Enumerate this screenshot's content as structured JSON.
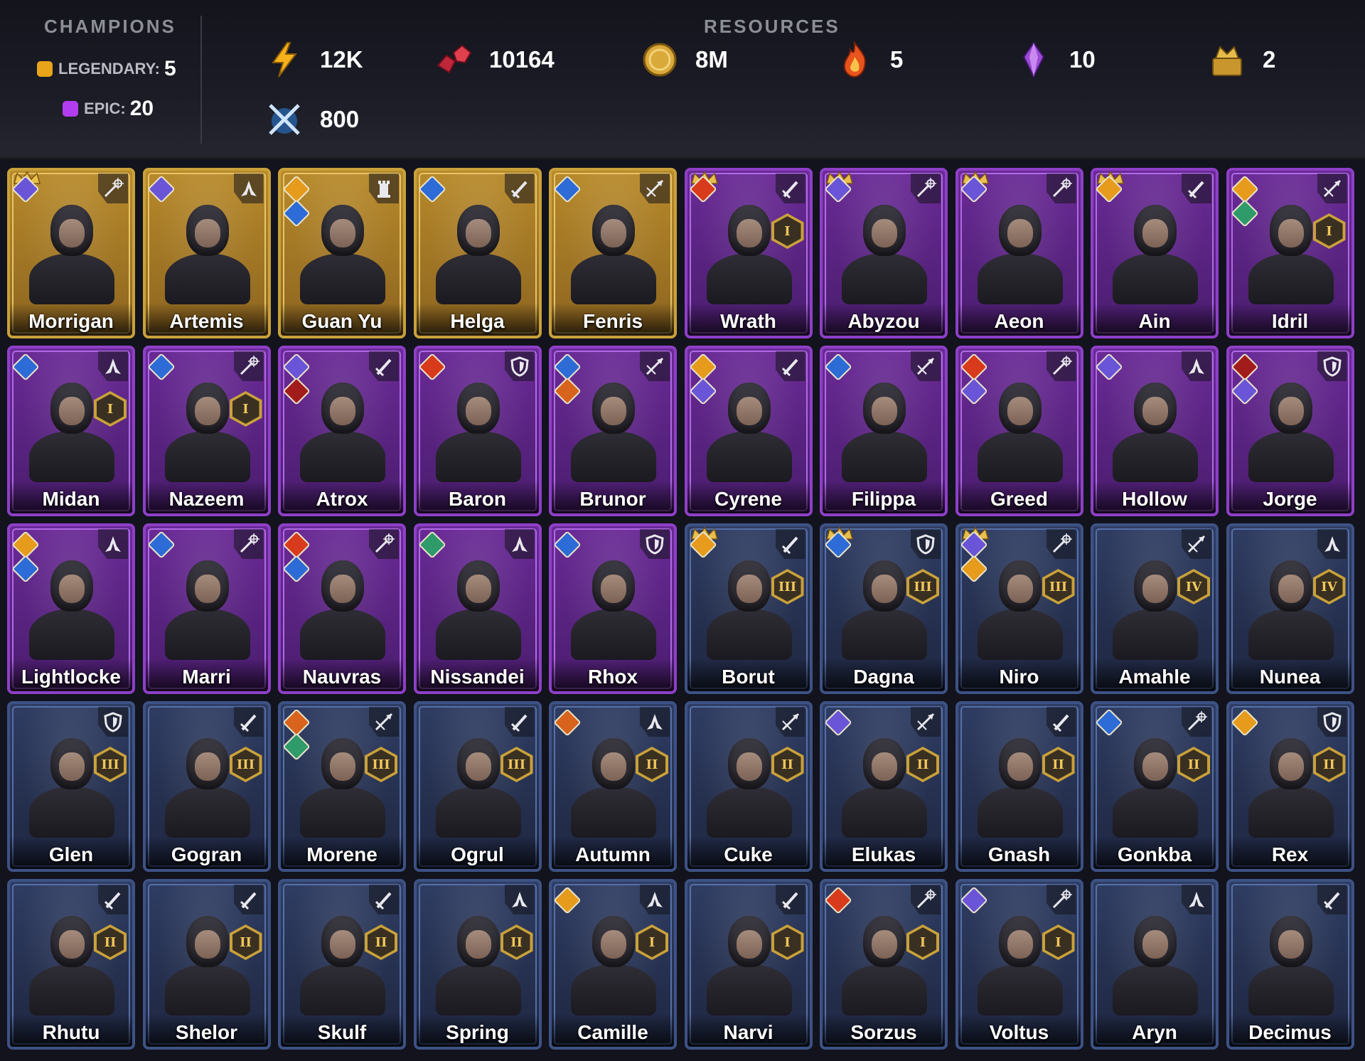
{
  "champions": {
    "title": "CHAMPIONS",
    "legendary": {
      "label": "LEGENDARY:",
      "value": "5",
      "color": "#e9a419"
    },
    "epic": {
      "label": "EPIC:",
      "value": "20",
      "color": "#b23df0"
    }
  },
  "resources": {
    "title": "RESOURCES",
    "items": [
      {
        "icon": "energy-bolt-icon",
        "value": "12K"
      },
      {
        "icon": "rubies-icon",
        "value": "10164"
      },
      {
        "icon": "gold-coin-icon",
        "value": "8M"
      },
      {
        "icon": "fire-essence-icon",
        "value": "5"
      },
      {
        "icon": "void-crystal-icon",
        "value": "10"
      },
      {
        "icon": "gold-treasure-icon",
        "value": "2"
      },
      {
        "icon": "crossed-swords-icon",
        "value": "800"
      }
    ]
  },
  "colors": {
    "legendary_border": "#c9a13a",
    "epic_border": "#8e3fc7",
    "rare_border": "#3d5285"
  },
  "roster": [
    {
      "name": "Morrigan",
      "rarity": "legendary",
      "class": "magic",
      "crown": true,
      "affinities": [
        "#6a54d8"
      ],
      "rank": ""
    },
    {
      "name": "Artemis",
      "rarity": "legendary",
      "class": "support",
      "crown": false,
      "affinities": [
        "#6a54d8"
      ],
      "rank": ""
    },
    {
      "name": "Guan Yu",
      "rarity": "legendary",
      "class": "tower",
      "crown": false,
      "affinities": [
        "#e69b1c",
        "#2d6bd6"
      ],
      "rank": ""
    },
    {
      "name": "Helga",
      "rarity": "legendary",
      "class": "melee",
      "crown": false,
      "affinities": [
        "#2d6bd6"
      ],
      "rank": ""
    },
    {
      "name": "Fenris",
      "rarity": "legendary",
      "class": "ranged",
      "crown": false,
      "affinities": [
        "#2d6bd6"
      ],
      "rank": ""
    },
    {
      "name": "Wrath",
      "rarity": "epic",
      "class": "melee",
      "crown": true,
      "affinities": [
        "#d83a1c"
      ],
      "rank": "I"
    },
    {
      "name": "Abyzou",
      "rarity": "epic",
      "class": "magic",
      "crown": true,
      "affinities": [
        "#6a54d8"
      ],
      "rank": ""
    },
    {
      "name": "Aeon",
      "rarity": "epic",
      "class": "magic",
      "crown": true,
      "affinities": [
        "#6a54d8"
      ],
      "rank": ""
    },
    {
      "name": "Ain",
      "rarity": "epic",
      "class": "melee",
      "crown": true,
      "affinities": [
        "#e69b1c"
      ],
      "rank": ""
    },
    {
      "name": "Idril",
      "rarity": "epic",
      "class": "ranged",
      "crown": false,
      "affinities": [
        "#e69b1c",
        "#2f9a6a"
      ],
      "rank": "I"
    },
    {
      "name": "Midan",
      "rarity": "epic",
      "class": "support",
      "crown": false,
      "affinities": [
        "#2d6bd6"
      ],
      "rank": "I"
    },
    {
      "name": "Nazeem",
      "rarity": "epic",
      "class": "magic",
      "crown": false,
      "affinities": [
        "#2d6bd6"
      ],
      "rank": "I"
    },
    {
      "name": "Atrox",
      "rarity": "epic",
      "class": "melee",
      "crown": false,
      "affinities": [
        "#6a54d8",
        "#a31c1c"
      ],
      "rank": ""
    },
    {
      "name": "Baron",
      "rarity": "epic",
      "class": "tank",
      "crown": false,
      "affinities": [
        "#d83a1c"
      ],
      "rank": ""
    },
    {
      "name": "Brunor",
      "rarity": "epic",
      "class": "ranged",
      "crown": false,
      "affinities": [
        "#2d6bd6",
        "#d8631c"
      ],
      "rank": ""
    },
    {
      "name": "Cyrene",
      "rarity": "epic",
      "class": "melee",
      "crown": false,
      "affinities": [
        "#e69b1c",
        "#6a54d8"
      ],
      "rank": ""
    },
    {
      "name": "Filippa",
      "rarity": "epic",
      "class": "ranged",
      "crown": false,
      "affinities": [
        "#2d6bd6"
      ],
      "rank": ""
    },
    {
      "name": "Greed",
      "rarity": "epic",
      "class": "magic",
      "crown": false,
      "affinities": [
        "#d83a1c",
        "#6a54d8"
      ],
      "rank": ""
    },
    {
      "name": "Hollow",
      "rarity": "epic",
      "class": "support",
      "crown": false,
      "affinities": [
        "#6a54d8"
      ],
      "rank": ""
    },
    {
      "name": "Jorge",
      "rarity": "epic",
      "class": "tank",
      "crown": false,
      "affinities": [
        "#a31c1c",
        "#6a54d8"
      ],
      "rank": ""
    },
    {
      "name": "Lightlocke",
      "rarity": "epic",
      "class": "support",
      "crown": false,
      "affinities": [
        "#e69b1c",
        "#2d6bd6"
      ],
      "rank": ""
    },
    {
      "name": "Marri",
      "rarity": "epic",
      "class": "magic",
      "crown": false,
      "affinities": [
        "#2d6bd6"
      ],
      "rank": ""
    },
    {
      "name": "Nauvras",
      "rarity": "epic",
      "class": "magic",
      "crown": false,
      "affinities": [
        "#d83a1c",
        "#2d6bd6"
      ],
      "rank": ""
    },
    {
      "name": "Nissandei",
      "rarity": "epic",
      "class": "support",
      "crown": false,
      "affinities": [
        "#2f9a6a"
      ],
      "rank": ""
    },
    {
      "name": "Rhox",
      "rarity": "epic",
      "class": "tank",
      "crown": false,
      "affinities": [
        "#2d6bd6"
      ],
      "rank": ""
    },
    {
      "name": "Borut",
      "rarity": "rare",
      "class": "melee",
      "crown": true,
      "affinities": [
        "#e69b1c"
      ],
      "rank": "III"
    },
    {
      "name": "Dagna",
      "rarity": "rare",
      "class": "tank",
      "crown": true,
      "affinities": [
        "#2d6bd6"
      ],
      "rank": "III"
    },
    {
      "name": "Niro",
      "rarity": "rare",
      "class": "magic",
      "crown": true,
      "affinities": [
        "#6a54d8",
        "#e69b1c"
      ],
      "rank": "III"
    },
    {
      "name": "Amahle",
      "rarity": "rare",
      "class": "ranged",
      "crown": false,
      "affinities": [],
      "rank": "IV"
    },
    {
      "name": "Nunea",
      "rarity": "rare",
      "class": "support",
      "crown": false,
      "affinities": [],
      "rank": "IV"
    },
    {
      "name": "Glen",
      "rarity": "rare",
      "class": "tank",
      "crown": false,
      "affinities": [],
      "rank": "III"
    },
    {
      "name": "Gogran",
      "rarity": "rare",
      "class": "melee",
      "crown": false,
      "affinities": [],
      "rank": "III"
    },
    {
      "name": "Morene",
      "rarity": "rare",
      "class": "ranged",
      "crown": false,
      "affinities": [
        "#d8631c",
        "#2f9a6a"
      ],
      "rank": "III"
    },
    {
      "name": "Ogrul",
      "rarity": "rare",
      "class": "melee",
      "crown": false,
      "affinities": [],
      "rank": "III"
    },
    {
      "name": "Autumn",
      "rarity": "rare",
      "class": "support",
      "crown": false,
      "affinities": [
        "#d8631c"
      ],
      "rank": "II"
    },
    {
      "name": "Cuke",
      "rarity": "rare",
      "class": "ranged",
      "crown": false,
      "affinities": [],
      "rank": "II"
    },
    {
      "name": "Elukas",
      "rarity": "rare",
      "class": "ranged",
      "crown": false,
      "affinities": [
        "#6a54d8"
      ],
      "rank": "II"
    },
    {
      "name": "Gnash",
      "rarity": "rare",
      "class": "melee",
      "crown": false,
      "affinities": [],
      "rank": "II"
    },
    {
      "name": "Gonkba",
      "rarity": "rare",
      "class": "magic",
      "crown": false,
      "affinities": [
        "#2d6bd6"
      ],
      "rank": "II"
    },
    {
      "name": "Rex",
      "rarity": "rare",
      "class": "tank",
      "crown": false,
      "affinities": [
        "#e69b1c"
      ],
      "rank": "II"
    },
    {
      "name": "Rhutu",
      "rarity": "rare",
      "class": "melee",
      "crown": false,
      "affinities": [],
      "rank": "II"
    },
    {
      "name": "Shelor",
      "rarity": "rare",
      "class": "melee",
      "crown": false,
      "affinities": [],
      "rank": "II"
    },
    {
      "name": "Skulf",
      "rarity": "rare",
      "class": "melee",
      "crown": false,
      "affinities": [],
      "rank": "II"
    },
    {
      "name": "Spring",
      "rarity": "rare",
      "class": "support",
      "crown": false,
      "affinities": [],
      "rank": "II"
    },
    {
      "name": "Camille",
      "rarity": "rare",
      "class": "support",
      "crown": false,
      "affinities": [
        "#e69b1c"
      ],
      "rank": "I"
    },
    {
      "name": "Narvi",
      "rarity": "rare",
      "class": "melee",
      "crown": false,
      "affinities": [],
      "rank": "I"
    },
    {
      "name": "Sorzus",
      "rarity": "rare",
      "class": "magic",
      "crown": false,
      "affinities": [
        "#d83a1c"
      ],
      "rank": "I"
    },
    {
      "name": "Voltus",
      "rarity": "rare",
      "class": "magic",
      "crown": false,
      "affinities": [
        "#6a54d8"
      ],
      "rank": "I"
    },
    {
      "name": "Aryn",
      "rarity": "rare",
      "class": "support",
      "crown": false,
      "affinities": [],
      "rank": ""
    },
    {
      "name": "Decimus",
      "rarity": "rare",
      "class": "melee",
      "crown": false,
      "affinities": [],
      "rank": ""
    }
  ]
}
